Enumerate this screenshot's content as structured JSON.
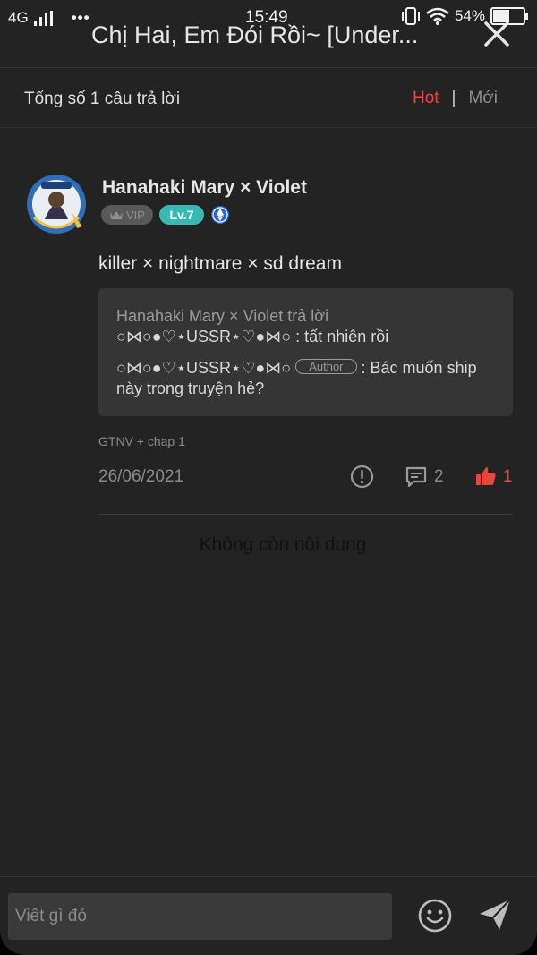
{
  "status_bar": {
    "network": "4G",
    "time": "15:49",
    "battery": "54%"
  },
  "header": {
    "title": "Chị Hai, Em Đói Rồi~ [Under...",
    "close_icon": "close-icon"
  },
  "sort_bar": {
    "total_label": "Tổng số 1 câu trả lời",
    "hot_label": "Hot",
    "separator": "|",
    "new_label": "Mới",
    "active_color": "#e8473f"
  },
  "comment": {
    "username": "Hanahaki Mary × Violet",
    "vip_label": "VIP",
    "level_label": "Lv.7",
    "text": "killer × nightmare × sd dream",
    "quote": {
      "header": "Hanahaki Mary × Violet trả lời",
      "line1": "○⋈○●♡⋆USSR⋆♡●⋈○ : tất nhiên rồi",
      "line2_prefix": "○⋈○●♡⋆USSR⋆♡●⋈○",
      "author_tag": "Author",
      "line2_text": " : Bác muốn ship này trong truyện hẻ?"
    },
    "source": "GTNV + chap 1",
    "date": "26/06/2021",
    "reply_count": "2",
    "like_count": "1",
    "like_color": "#e8473f",
    "level_color": "#38b9b4"
  },
  "footer_note": "Không còn nội dung",
  "composer": {
    "placeholder": "Viết gì đó",
    "emoji_icon": "smiley-icon",
    "send_icon": "send-icon"
  }
}
